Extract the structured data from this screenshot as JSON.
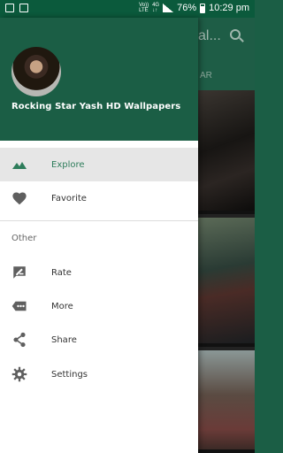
{
  "status_bar": {
    "network_top": "Vo))",
    "network_bottom": "LTE",
    "data_top": "4G",
    "data_bottom": "↓↑",
    "battery_percent": "76%",
    "time": "10:29 pm"
  },
  "background_app": {
    "toolbar_title_partial": "al...",
    "tab_partial": "AR"
  },
  "drawer": {
    "header_title": "Rocking Star Yash HD Wallpapers",
    "items": [
      {
        "label": "Explore",
        "icon": "landscape-icon",
        "selected": true
      },
      {
        "label": "Favorite",
        "icon": "heart-icon",
        "selected": false
      }
    ],
    "section_title": "Other",
    "other_items": [
      {
        "label": "Rate",
        "icon": "rate-review-icon"
      },
      {
        "label": "More",
        "icon": "more-tag-icon"
      },
      {
        "label": "Share",
        "icon": "share-icon"
      },
      {
        "label": "Settings",
        "icon": "settings-gear-icon"
      }
    ]
  },
  "colors": {
    "primary": "#1b5e45",
    "status_bar": "#0b5a3c",
    "accent_selected": "#2e7d5b",
    "selected_bg": "#e6e6e6"
  }
}
